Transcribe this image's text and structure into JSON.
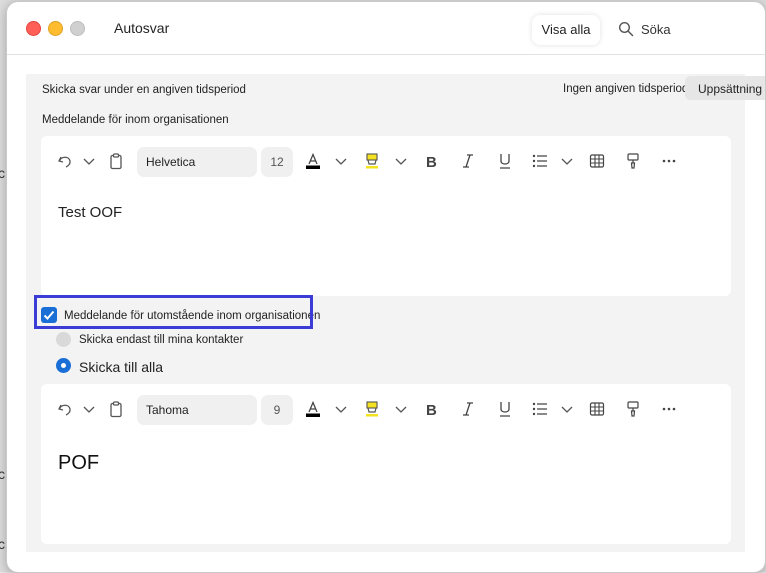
{
  "window": {
    "title": "Autosvar"
  },
  "header": {
    "show_all_label": "Visa alla",
    "search_label": "Söka"
  },
  "settings": {
    "send_period_label": "Skicka svar under en angiven tidsperiod",
    "period_value": "Ingen angiven tidsperiod",
    "setup_button": "Uppsättning",
    "internal_label": "Meddelande för inom organisationen",
    "external_checkbox_label": "Meddelande för utomstående inom organisationen",
    "external_checkbox_checked": true,
    "radio_contacts_label": "Skicka endast till mina kontakter",
    "radio_all_label": "Skicka till alla",
    "selected_radio": "Skicka till alla"
  },
  "editor_internal": {
    "font": "Helvetica",
    "size": "12",
    "body": "Test OOF"
  },
  "editor_external": {
    "font": "Tahoma",
    "size": "9",
    "body": "POF"
  },
  "colors": {
    "accent": "#1a6fd6",
    "highlight_border": "#3b3bd6",
    "text_color_bar": "#000000",
    "highlighter": "#f3e21f"
  }
}
